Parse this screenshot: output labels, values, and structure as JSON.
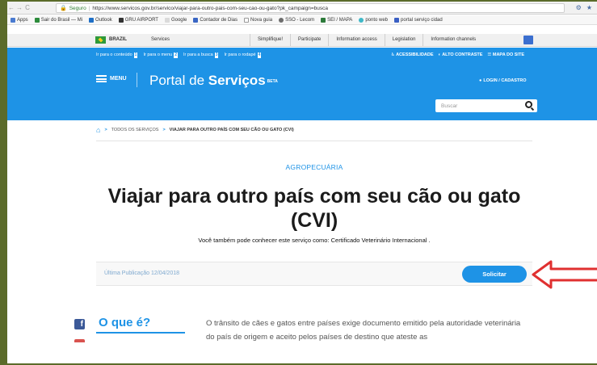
{
  "browser": {
    "nav": [
      "←",
      "→",
      "C"
    ],
    "secure_label": "Seguro",
    "url": "https://www.servicos.gov.br/servico/viajar-para-outro-pais-com-seu-cao-ou-gato?pk_campaign=busca",
    "bookmarks": [
      "Apps",
      "Sair do Brasil — Mi",
      "Outlook",
      "GRU AIRPORT",
      "Google",
      "Contador de Dias",
      "Nova guia",
      "SSO - Lecom",
      "SEI / MAPA",
      "ponto web",
      "portal serviço cidad"
    ]
  },
  "gov_bar": {
    "brazil": "BRAZIL",
    "services": "Services",
    "links": [
      "Simplifique!",
      "Participate",
      "Information access",
      "Legislation",
      "Information channels"
    ]
  },
  "accessibility": {
    "skip_links": [
      {
        "label": "Ir para o conteúdo",
        "num": "1"
      },
      {
        "label": "Ir para o menu",
        "num": "2"
      },
      {
        "label": "Ir para a busca",
        "num": "3"
      },
      {
        "label": "Ir para o rodapé",
        "num": "4"
      }
    ],
    "options": [
      "ACESSIBILIDADE",
      "ALTO CONTRASTE",
      "MAPA DO SITE"
    ]
  },
  "header": {
    "menu_label": "MENU",
    "portal_title_pre": "Portal de ",
    "portal_title_bold": "Serviços",
    "beta": "BETA",
    "login": "LOGIN / CADASTRO",
    "search_placeholder": "Buscar"
  },
  "breadcrumb": {
    "level1": "TODOS OS SERVIÇOS",
    "current": "VIAJAR PARA OUTRO PAÍS COM SEU CÃO OU GATO (CVI)"
  },
  "service": {
    "category": "AGROPECUÁRIA",
    "title": "Viajar para outro país com seu cão ou gato (CVI)",
    "also_known_prefix": "Você também pode conhecer este serviço como:",
    "also_known_value": "Certificado Veterinário Internacional .",
    "published": "Última Publicação 12/04/2018",
    "request_button": "Solicitar"
  },
  "section": {
    "title": "O que é?",
    "text": "O trânsito de cães e gatos entre países exige documento emitido pela autoridade veterinária do país de origem e aceito pelos países de destino que ateste as"
  },
  "colors": {
    "primary": "#1e93e6",
    "annotation": "#e03030"
  }
}
